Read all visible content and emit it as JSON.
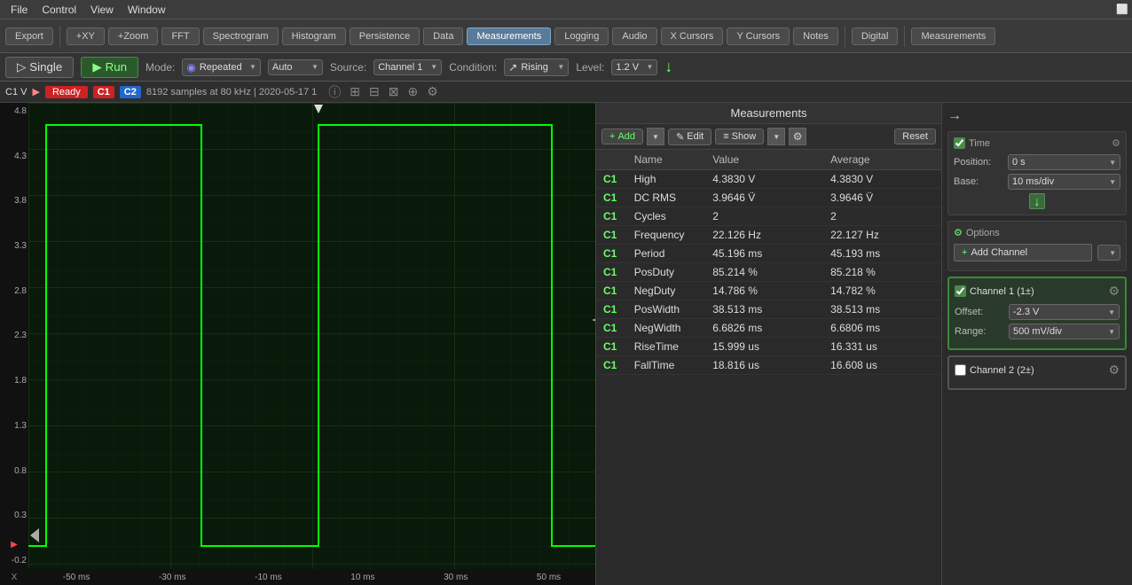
{
  "menubar": {
    "items": [
      "File",
      "Control",
      "View",
      "Window"
    ]
  },
  "toolbar": {
    "tabs": [
      {
        "label": "Export",
        "active": false
      },
      {
        "label": "+XY",
        "active": false
      },
      {
        "label": "+Zoom",
        "active": false
      },
      {
        "label": "FFT",
        "active": false
      },
      {
        "label": "Spectrogram",
        "active": false
      },
      {
        "label": "Histogram",
        "active": false
      },
      {
        "label": "Persistence",
        "active": false
      },
      {
        "label": "Data",
        "active": false
      },
      {
        "label": "Measurements",
        "active": true
      },
      {
        "label": "Logging",
        "active": false
      },
      {
        "label": "Audio",
        "active": false
      },
      {
        "label": "X Cursors",
        "active": false
      },
      {
        "label": "Y Cursors",
        "active": false
      },
      {
        "label": "Notes",
        "active": false
      },
      {
        "label": "Digital",
        "active": false
      },
      {
        "label": "Measurements",
        "active": false
      }
    ]
  },
  "trigger": {
    "single_label": "Single",
    "run_label": "Run",
    "mode_label": "Mode:",
    "mode_value": "Repeated",
    "auto_value": "Auto",
    "source_label": "Source:",
    "source_value": "Channel 1",
    "condition_label": "Condition:",
    "condition_value": "Rising",
    "level_label": "Level:",
    "level_value": "1.2 V"
  },
  "status": {
    "ch1_label": "C1",
    "ch2_label": "C2",
    "ready_label": "Ready",
    "info": "8192 samples at 80 kHz | 2020-05-17 1"
  },
  "measurements_panel": {
    "title": "Measurements",
    "add_label": "Add",
    "edit_label": "Edit",
    "show_label": "Show",
    "reset_label": "Reset",
    "columns": {
      "ch": "",
      "name": "Name",
      "value": "Value",
      "average": "Average"
    },
    "rows": [
      {
        "ch": "C1",
        "name": "High",
        "value": "4.3830 V",
        "average": "4.3830 V"
      },
      {
        "ch": "C1",
        "name": "DC RMS",
        "value": "3.9646 V̈",
        "average": "3.9646 V̈"
      },
      {
        "ch": "C1",
        "name": "Cycles",
        "value": "2",
        "average": "2"
      },
      {
        "ch": "C1",
        "name": "Frequency",
        "value": "22.126 Hz",
        "average": "22.127 Hz"
      },
      {
        "ch": "C1",
        "name": "Period",
        "value": "45.196 ms",
        "average": "45.193 ms"
      },
      {
        "ch": "C1",
        "name": "PosDuty",
        "value": "85.214 %",
        "average": "85.218 %"
      },
      {
        "ch": "C1",
        "name": "NegDuty",
        "value": "14.786 %",
        "average": "14.782 %"
      },
      {
        "ch": "C1",
        "name": "PosWidth",
        "value": "38.513 ms",
        "average": "38.513 ms"
      },
      {
        "ch": "C1",
        "name": "NegWidth",
        "value": "6.6826 ms",
        "average": "6.6806 ms"
      },
      {
        "ch": "C1",
        "name": "RiseTime",
        "value": "15.999 us",
        "average": "16.331 us"
      },
      {
        "ch": "C1",
        "name": "FallTime",
        "value": "18.816 us",
        "average": "16.608 us"
      }
    ]
  },
  "right_panel": {
    "time_title": "Time",
    "position_label": "Position:",
    "position_value": "0 s",
    "base_label": "Base:",
    "base_value": "10 ms/div",
    "options_title": "Options",
    "add_channel_label": "Add Channel",
    "channel1": {
      "label": "Channel 1 (1±)",
      "checked": true,
      "offset_label": "Offset:",
      "offset_value": "-2.3 V",
      "range_label": "Range:",
      "range_value": "500 mV/div"
    },
    "channel2": {
      "label": "Channel 2 (2±)",
      "checked": false
    }
  },
  "scope": {
    "y_labels": [
      "4.8",
      "4.3",
      "3.8",
      "3.3",
      "2.8",
      "2.3",
      "1.8",
      "1.3",
      "0.8",
      "0.3",
      "-0.2"
    ],
    "x_labels": [
      "-50 ms",
      "-30 ms",
      "-10 ms",
      "10 ms",
      "30 ms",
      "50 ms"
    ]
  }
}
